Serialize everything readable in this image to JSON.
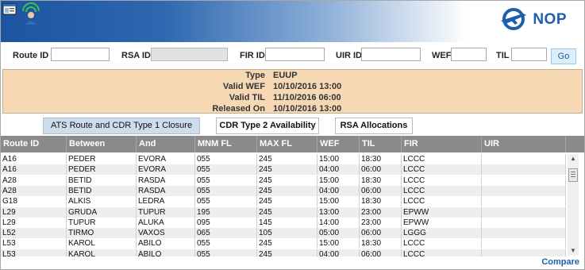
{
  "header": {
    "app_icon": "window-app-icon",
    "user_icon": "user-network-icon",
    "logo_icon": "airplane-logo-icon",
    "logo_text": "NOP"
  },
  "filters": {
    "route_id_label": "Route ID",
    "rsa_id_label": "RSA ID",
    "fir_id_label": "FIR ID",
    "uir_id_label": "UIR ID",
    "wef_label": "WEF",
    "til_label": "TIL",
    "go_label": "Go",
    "route_id_value": "",
    "rsa_id_value": "",
    "fir_id_value": "",
    "uir_id_value": "",
    "wef_value": "",
    "til_value": ""
  },
  "info": {
    "type_label": "Type",
    "type_value": "EUUP",
    "wef_label": "Valid WEF",
    "wef_value": "10/10/2016 13:00",
    "til_label": "Valid TIL",
    "til_value": "11/10/2016 06:00",
    "released_label": "Released On",
    "released_value": "10/10/2016 13:00"
  },
  "tabs": [
    {
      "label": "ATS Route and CDR Type 1 Closure",
      "active": true
    },
    {
      "label": "CDR Type 2 Availability",
      "active": false
    },
    {
      "label": "RSA Allocations",
      "active": false
    }
  ],
  "table": {
    "columns": [
      "Route ID",
      "Between",
      "And",
      "MNM FL",
      "MAX FL",
      "WEF",
      "TIL",
      "FIR",
      "UIR"
    ],
    "rows": [
      [
        "A16",
        "PEDER",
        "EVORA",
        "055",
        "245",
        "15:00",
        "18:30",
        "LCCC",
        ""
      ],
      [
        "A16",
        "PEDER",
        "EVORA",
        "055",
        "245",
        "04:00",
        "06:00",
        "LCCC",
        ""
      ],
      [
        "A28",
        "BETID",
        "RASDA",
        "055",
        "245",
        "15:00",
        "18:30",
        "LCCC",
        ""
      ],
      [
        "A28",
        "BETID",
        "RASDA",
        "055",
        "245",
        "04:00",
        "06:00",
        "LCCC",
        ""
      ],
      [
        "G18",
        "ALKIS",
        "LEDRA",
        "055",
        "245",
        "15:00",
        "18:30",
        "LCCC",
        ""
      ],
      [
        "L29",
        "GRUDA",
        "TUPUR",
        "195",
        "245",
        "13:00",
        "23:00",
        "EPWW",
        ""
      ],
      [
        "L29",
        "TUPUR",
        "ALUKA",
        "095",
        "145",
        "14:00",
        "23:00",
        "EPWW",
        ""
      ],
      [
        "L52",
        "TIRMO",
        "VAXOS",
        "065",
        "105",
        "05:00",
        "06:00",
        "LGGG",
        ""
      ],
      [
        "L53",
        "KAROL",
        "ABILO",
        "055",
        "245",
        "15:00",
        "18:30",
        "LCCC",
        ""
      ],
      [
        "L53",
        "KAROL",
        "ABILO",
        "055",
        "245",
        "04:00",
        "06:00",
        "LCCC",
        ""
      ]
    ]
  },
  "compare_label": "Compare"
}
